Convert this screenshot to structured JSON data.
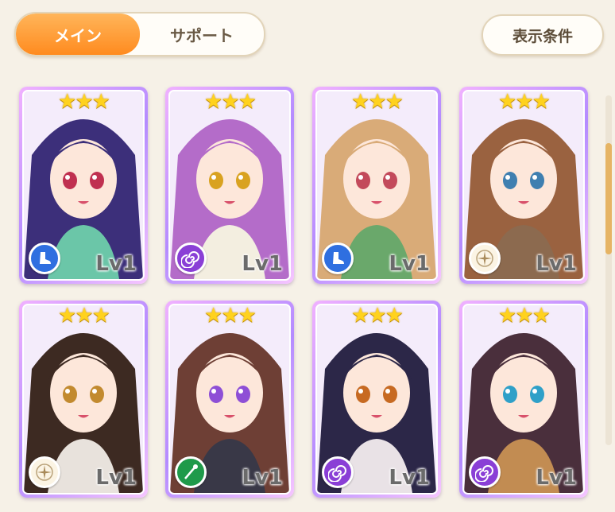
{
  "tabs": [
    {
      "label": "メイン",
      "active": true
    },
    {
      "label": "サポート",
      "active": false
    }
  ],
  "filter_button_label": "表示条件",
  "accent_color": "#ff8b1f",
  "cards": [
    {
      "stars": "★★★",
      "level": "Lv1",
      "type_icon": "boot-icon",
      "badge_color": "#2f6fe0",
      "hair": "#3c2f7a",
      "eye": "#c03050",
      "outfit": "#6bc6a8"
    },
    {
      "stars": "★★★",
      "level": "Lv1",
      "type_icon": "spiral-icon",
      "badge_color": "#8a3fd6",
      "hair": "#b46cc9",
      "eye": "#d9a220",
      "outfit": "#f3eee0"
    },
    {
      "stars": "★★★",
      "level": "Lv1",
      "type_icon": "boot-icon",
      "badge_color": "#2f6fe0",
      "hair": "#d9ab78",
      "eye": "#c34a5b",
      "outfit": "#6aa86b"
    },
    {
      "stars": "★★★",
      "level": "Lv1",
      "type_icon": "compass-icon",
      "badge_color": "#fbf4e4",
      "hair": "#9a6240",
      "eye": "#3f7fb0",
      "outfit": "#8c6a4f"
    },
    {
      "stars": "★★★",
      "level": "Lv1",
      "type_icon": "compass-icon",
      "badge_color": "#fbf4e4",
      "hair": "#3d2a22",
      "eye": "#c28a2f",
      "outfit": "#e8e2dc"
    },
    {
      "stars": "★★★",
      "level": "Lv1",
      "type_icon": "staff-icon",
      "badge_color": "#1f9a4a",
      "hair": "#6e3f35",
      "eye": "#8e4fd6",
      "outfit": "#393847"
    },
    {
      "stars": "★★★",
      "level": "Lv1",
      "type_icon": "spiral-icon",
      "badge_color": "#8a3fd6",
      "hair": "#2c2748",
      "eye": "#c76a22",
      "outfit": "#e9e2e6"
    },
    {
      "stars": "★★★",
      "level": "Lv1",
      "type_icon": "spiral-icon",
      "badge_color": "#8a3fd6",
      "hair": "#4a2f3c",
      "eye": "#2fa0c8",
      "outfit": "#c28c52"
    }
  ]
}
